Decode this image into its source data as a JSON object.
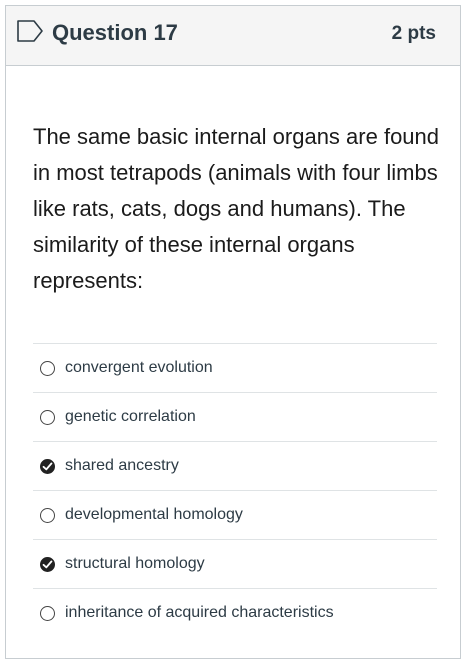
{
  "question": {
    "title": "Question 17",
    "points": "2 pts",
    "text": "The same basic internal organs  are found in most tetrapods (animals with four limbs like rats, cats, dogs and humans). The similarity of these internal organs represents:"
  },
  "answers": [
    {
      "label": "convergent evolution",
      "checked": false
    },
    {
      "label": "genetic correlation",
      "checked": false
    },
    {
      "label": "shared ancestry",
      "checked": true
    },
    {
      "label": "developmental homology",
      "checked": false
    },
    {
      "label": "structural homology",
      "checked": true
    },
    {
      "label": "inheritance of acquired characteristics",
      "checked": false
    }
  ],
  "icons": {
    "flag": "flag-outline-icon",
    "check": "checkmark-icon"
  }
}
